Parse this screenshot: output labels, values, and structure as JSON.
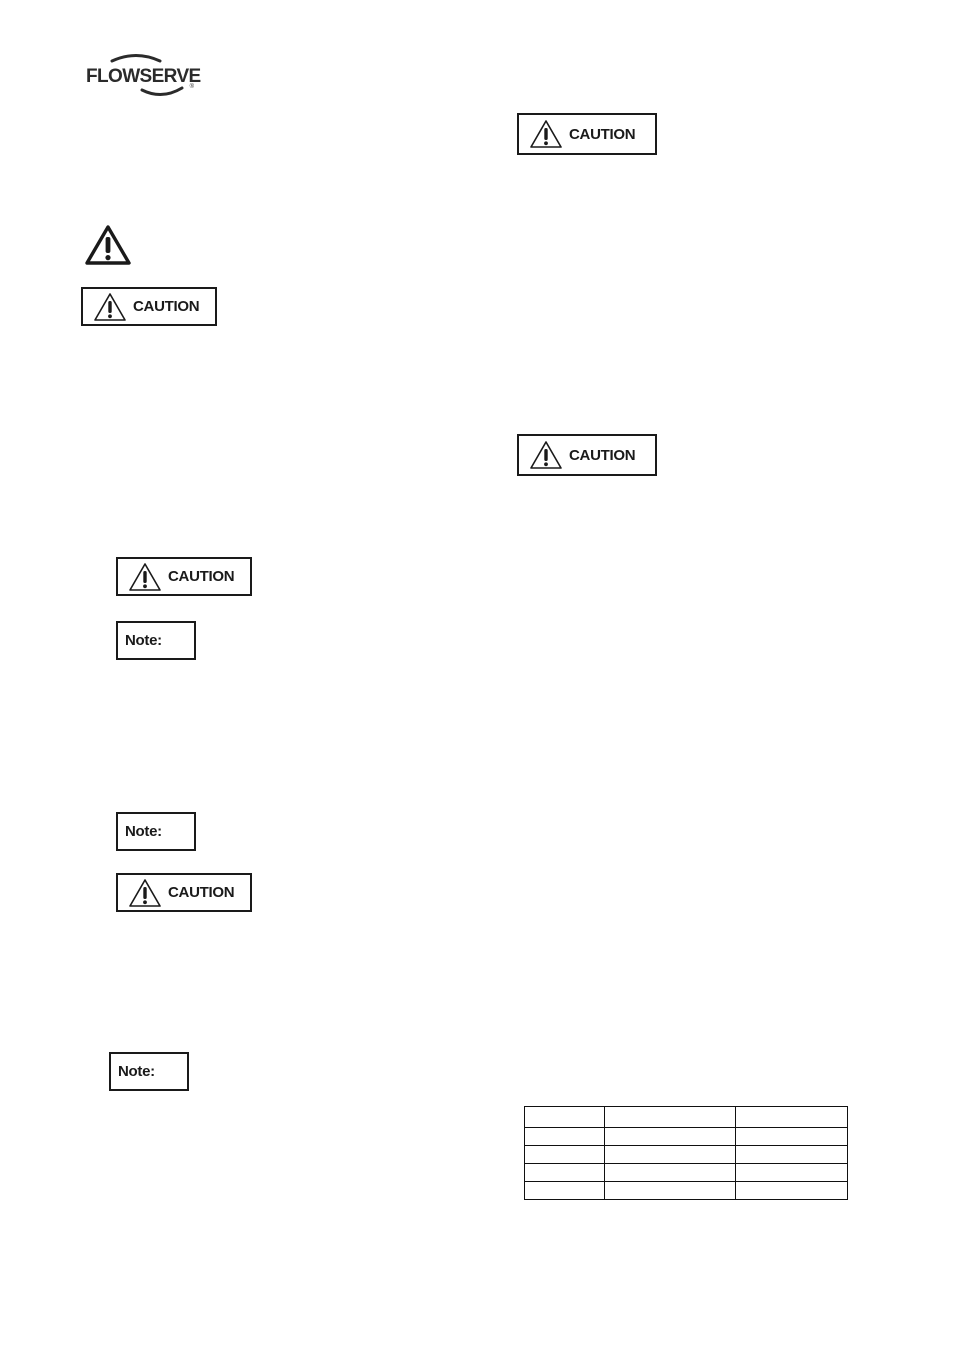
{
  "header": {
    "logo": {
      "text": "FLOWSERVE",
      "registered": "®",
      "icon": "flowserve-swoosh-logo"
    }
  },
  "standalone_warning": {
    "icon": "warning-triangle-icon"
  },
  "callouts": {
    "caution_label": "CAUTION",
    "note_label": "Note:",
    "caution_icon": "warning-triangle-icon"
  },
  "left_column": {
    "items": [
      {
        "type": "caution",
        "label": "CAUTION"
      },
      {
        "type": "caution",
        "label": "CAUTION"
      },
      {
        "type": "note",
        "label": "Note:"
      },
      {
        "type": "note",
        "label": "Note:"
      },
      {
        "type": "caution",
        "label": "CAUTION"
      },
      {
        "type": "note",
        "label": "Note:"
      }
    ]
  },
  "right_column": {
    "items": [
      {
        "type": "caution",
        "label": "CAUTION"
      },
      {
        "type": "caution",
        "label": "CAUTION"
      }
    ],
    "table": {
      "columns": 3,
      "rows": [
        [
          "",
          "",
          ""
        ],
        [
          "",
          "",
          ""
        ],
        [
          "",
          "",
          ""
        ],
        [
          "",
          "",
          ""
        ],
        [
          "",
          "",
          ""
        ]
      ]
    }
  },
  "colors": {
    "ink": "#1a1a1a",
    "background": "#ffffff"
  }
}
